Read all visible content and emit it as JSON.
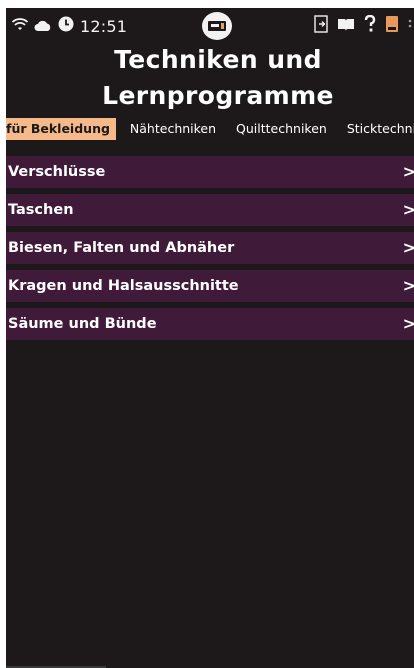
{
  "status": {
    "time": "12:51",
    "left_icons": [
      "wifi-icon",
      "cloud-icon",
      "clock-icon"
    ],
    "right_icons": [
      "exit-icon",
      "book-icon",
      "help-icon",
      "manual-icon"
    ]
  },
  "title": {
    "line1": "Techniken und",
    "line2": "Lernprogramme"
  },
  "tabs": [
    {
      "label": "für Bekleidung",
      "active": true
    },
    {
      "label": "Nähtechniken",
      "active": false
    },
    {
      "label": "Quilttechniken",
      "active": false
    },
    {
      "label": "Sticktechniken",
      "active": false
    }
  ],
  "categories": [
    {
      "label": "Verschlüsse"
    },
    {
      "label": "Taschen"
    },
    {
      "label": "Biesen, Falten und Abnäher"
    },
    {
      "label": "Kragen und Halsausschnitte"
    },
    {
      "label": "Säume und Bünde"
    }
  ],
  "colors": {
    "background": "#1d191b",
    "row": "#401a39",
    "active_tab": "#f6b98a",
    "manual_icon": "#e89a5c"
  }
}
